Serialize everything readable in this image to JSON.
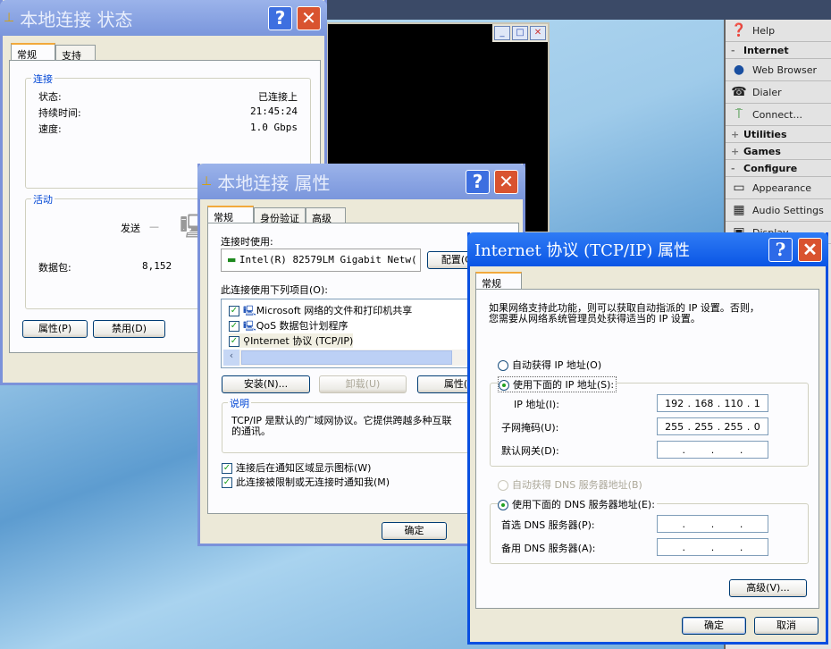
{
  "console_window": {
    "buttons": [
      "minimize",
      "maximize",
      "close"
    ]
  },
  "side_panel": {
    "items": [
      {
        "type": "item",
        "icon": "help-icon",
        "label": "Help"
      },
      {
        "type": "header",
        "sign": "-",
        "label": "Internet"
      },
      {
        "type": "item",
        "icon": "globe-icon",
        "label": "Web Browser"
      },
      {
        "type": "item",
        "icon": "phone-icon",
        "label": "Dialer"
      },
      {
        "type": "item",
        "icon": "signpost-icon",
        "label": "Connect..."
      },
      {
        "type": "header",
        "sign": "+",
        "label": "Utilities"
      },
      {
        "type": "header",
        "sign": "+",
        "label": "Games"
      },
      {
        "type": "header",
        "sign": "-",
        "label": "Configure"
      },
      {
        "type": "item",
        "icon": "appearance-icon",
        "label": "Appearance"
      },
      {
        "type": "item",
        "icon": "audio-icon",
        "label": "Audio Settings"
      },
      {
        "type": "item",
        "icon": "display-icon",
        "label": "Display"
      }
    ]
  },
  "status_dialog": {
    "title": "本地连接 状态",
    "tabs": [
      "常规",
      "支持"
    ],
    "connection_group": "连接",
    "rows": [
      {
        "label": "状态:",
        "value": "已连接上"
      },
      {
        "label": "持续时间:",
        "value": "21:45:24"
      },
      {
        "label": "速度:",
        "value": "1.0 Gbps"
      }
    ],
    "activity_group": "活动",
    "sent_label": "发送",
    "packets_label": "数据包:",
    "packets_sent": "8,152",
    "buttons": [
      "属性(P)",
      "禁用(D)"
    ]
  },
  "properties_dialog": {
    "title": "本地连接 属性",
    "tabs": [
      "常规",
      "身份验证",
      "高级"
    ],
    "connect_using_label": "连接时使用:",
    "adapter": "Intel(R) 82579LM Gigabit Netw(",
    "configure_button": "配置(C)",
    "items_label": "此连接使用下列项目(O):",
    "items": [
      {
        "label": "Microsoft 网络的文件和打印机共享",
        "checked": true
      },
      {
        "label": "QoS 数据包计划程序",
        "checked": true
      },
      {
        "label": "Internet 协议 (TCP/IP)",
        "checked": true
      }
    ],
    "buttons": [
      "安装(N)...",
      "卸载(U)",
      "属性(R)"
    ],
    "description_group": "说明",
    "description": "TCP/IP 是默认的广域网协议。它提供跨越多种互联网络的通讯。",
    "description_line1": "TCP/IP 是默认的广域网协议。它提供跨越多种互联",
    "description_line2": "的通讯。",
    "checkboxes": [
      {
        "label": "连接后在通知区域显示图标(W)",
        "checked": true
      },
      {
        "label": "此连接被限制或无连接时通知我(M)",
        "checked": true
      }
    ],
    "ok": "确定"
  },
  "tcpip_dialog": {
    "title": "Internet 协议 (TCP/IP) 属性",
    "tab": "常规",
    "intro_line1": "如果网络支持此功能，则可以获取自动指派的 IP 设置。否则，",
    "intro_line2": "您需要从网络系统管理员处获得适当的 IP 设置。",
    "auto_ip": "自动获得 IP 地址(O)",
    "manual_ip": "使用下面的 IP 地址(S):",
    "ip_mode": "manual",
    "ip_label": "IP 地址(I):",
    "ip": [
      "192",
      "168",
      "110",
      "1"
    ],
    "mask_label": "子网掩码(U):",
    "mask": [
      "255",
      "255",
      "255",
      "0"
    ],
    "gateway_label": "默认网关(D):",
    "gateway": [
      "",
      "",
      "",
      ""
    ],
    "auto_dns": "自动获得 DNS 服务器地址(B)",
    "manual_dns": "使用下面的 DNS 服务器地址(E):",
    "dns_mode": "manual",
    "dns1_label": "首选 DNS 服务器(P):",
    "dns2_label": "备用 DNS 服务器(A):",
    "advanced": "高级(V)...",
    "ok": "确定",
    "cancel": "取消"
  }
}
